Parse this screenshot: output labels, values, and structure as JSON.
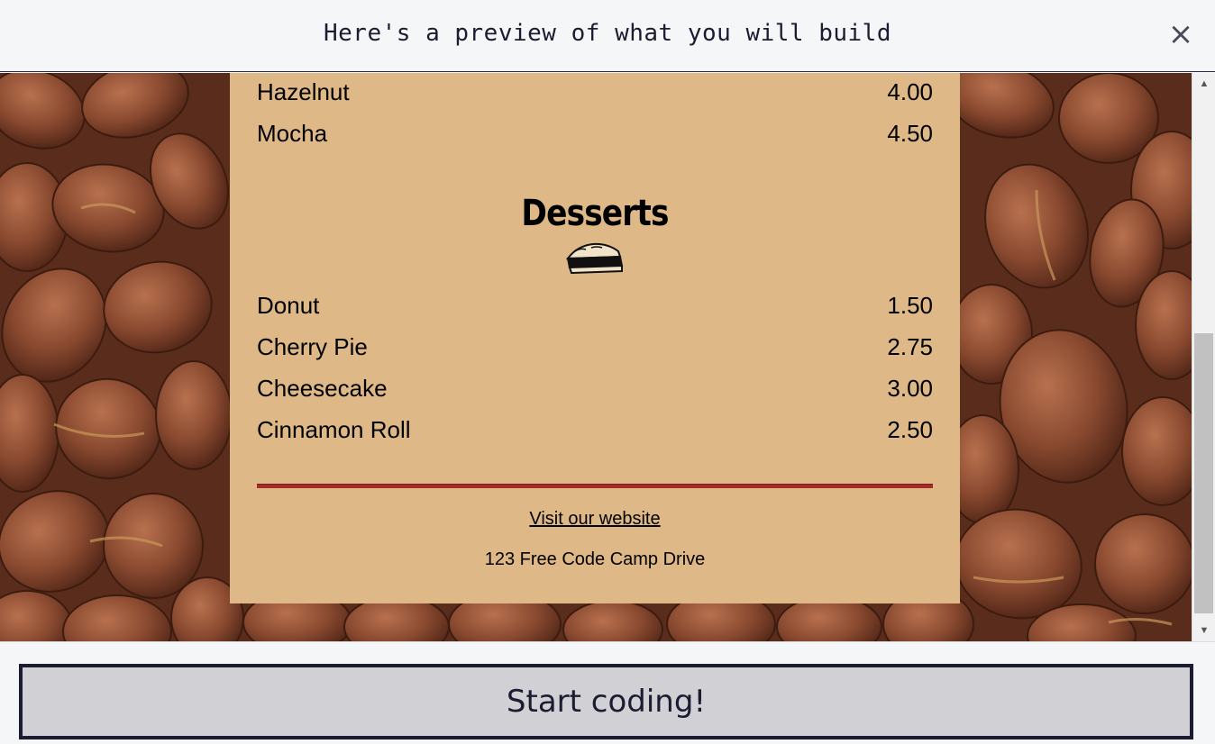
{
  "modal": {
    "title": "Here's a preview of what you will build",
    "close_label": "×"
  },
  "menu": {
    "top_items": [
      {
        "flavor": "Hazelnut",
        "price": "4.00"
      },
      {
        "flavor": "Mocha",
        "price": "4.50"
      }
    ],
    "desserts_title": "Desserts",
    "dessert_icon": "pie-icon",
    "desserts": [
      {
        "item": "Donut",
        "price": "1.50"
      },
      {
        "item": "Cherry Pie",
        "price": "2.75"
      },
      {
        "item": "Cheesecake",
        "price": "3.00"
      },
      {
        "item": "Cinnamon Roll",
        "price": "2.50"
      }
    ],
    "footer_link": "Visit our website",
    "address": "123 Free Code Camp Drive"
  },
  "scrollbar": {
    "up_arrow": "▲",
    "down_arrow": "▼"
  },
  "actions": {
    "start_label": "Start coding!"
  },
  "colors": {
    "menu_background": "#deb887",
    "divider": "#a52a2a",
    "button_border": "#1b1b32",
    "button_background": "#d0d0d5"
  }
}
